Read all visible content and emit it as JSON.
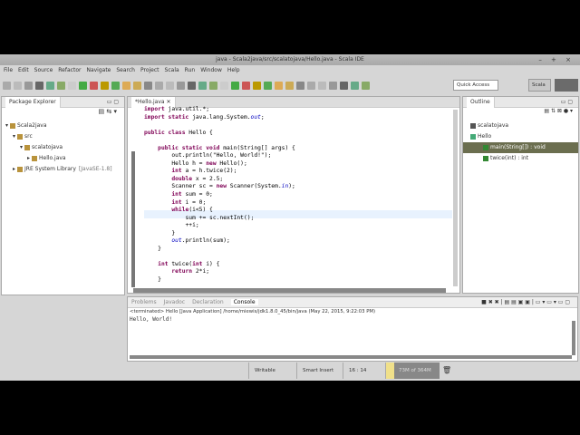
{
  "window": {
    "title": "java - Scala2java/src/scalatojava/Hello.java - Scala IDE",
    "controls": "– + ×"
  },
  "menu": [
    "File",
    "Edit",
    "Source",
    "Refactor",
    "Navigate",
    "Search",
    "Project",
    "Scala",
    "Run",
    "Window",
    "Help"
  ],
  "toolbar": {
    "quick_access": "Quick Access",
    "perspective": "Scala"
  },
  "package_explorer": {
    "title": "Package Explorer",
    "items": [
      {
        "label": "Scala2java",
        "depth": 0,
        "arrow": "▾"
      },
      {
        "label": "src",
        "depth": 1,
        "arrow": "▾"
      },
      {
        "label": "scalatojava",
        "depth": 2,
        "arrow": "▾"
      },
      {
        "label": "Hello.java",
        "depth": 3,
        "arrow": "▸"
      },
      {
        "label": "JRE System Library",
        "depth": 1,
        "arrow": "▸",
        "suffix": "[JavaSE-1.8]"
      }
    ]
  },
  "editor": {
    "tab": "*Hello.java",
    "lines": [
      "import java.util.*;",
      "import static java.lang.System.out;",
      "",
      "public class Hello {",
      "",
      "    public static void main(String[] args) {",
      "        out.println(\"Hello, World!\");",
      "        Hello h = new Hello();",
      "        int a = h.twice(2);",
      "        double x = 2.5;",
      "        Scanner sc = new Scanner(System.in);",
      "        int sum = 0;",
      "        int i = 0;",
      "        while(i<5) {",
      "            sum += sc.nextInt();",
      "            ++i;",
      "        }",
      "        out.println(sum);",
      "    }",
      "",
      "    int twice(int i) {",
      "        return 2*i;",
      "    }"
    ]
  },
  "outline": {
    "title": "Outline",
    "items": [
      {
        "label": "scalatojava",
        "selected": false
      },
      {
        "label": "Hello",
        "selected": false
      },
      {
        "label": "main(String[]) : void",
        "selected": true
      },
      {
        "label": "twice(int) : int",
        "selected": false
      }
    ]
  },
  "console": {
    "tabs": [
      "Problems",
      "Javadoc",
      "Declaration",
      "Console"
    ],
    "active": "Console",
    "header": "<terminated> Hello [Java Application] /home/miewis/jdk1.8.0_45/bin/java (May 22, 2015, 9:22:03 PM)",
    "output": "Hello, World!"
  },
  "status": {
    "writable": "Writable",
    "insert": "Smart Insert",
    "position": "16 : 14",
    "heap": "73M of 364M"
  }
}
